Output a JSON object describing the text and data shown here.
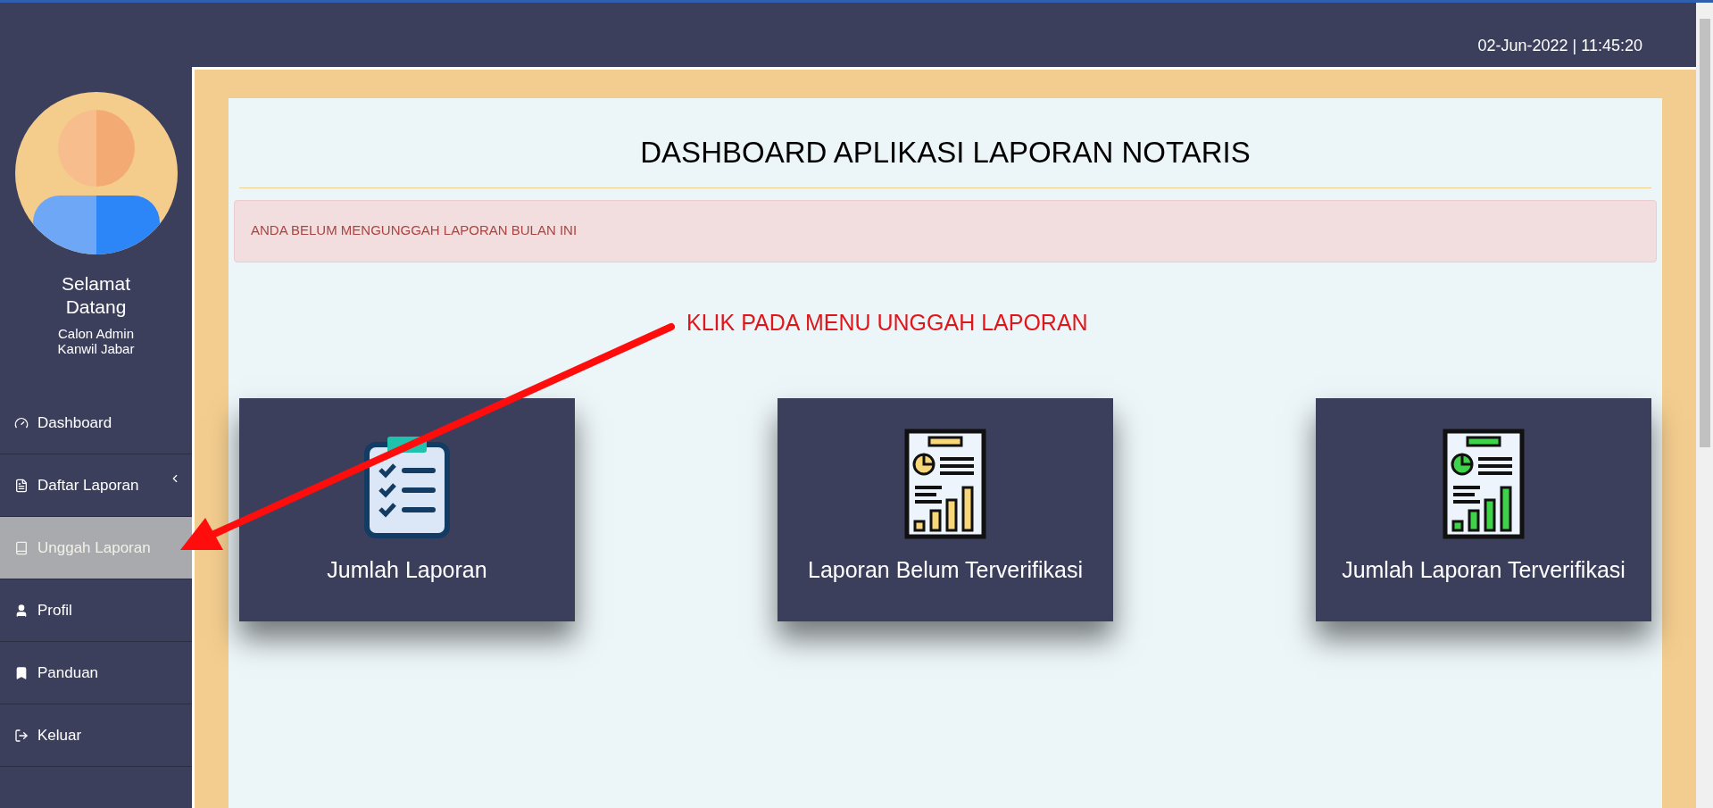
{
  "header": {
    "date_time": "02-Jun-2022 | 11:45:20"
  },
  "sidebar": {
    "greeting": "Selamat Datang",
    "user_lines": [
      "Calon Admin",
      "Kanwil Jabar"
    ],
    "menu": [
      {
        "label": "Dashboard",
        "kind": "gauge",
        "selected": false,
        "has_submenu": false
      },
      {
        "label": "Daftar Laporan",
        "kind": "file",
        "selected": false,
        "has_submenu": true
      },
      {
        "label": "Unggah Laporan",
        "kind": "book",
        "selected": true,
        "has_submenu": false
      },
      {
        "label": "Profil",
        "kind": "user",
        "selected": false,
        "has_submenu": false
      },
      {
        "label": "Panduan",
        "kind": "bookmark",
        "selected": false,
        "has_submenu": false
      },
      {
        "label": "Keluar",
        "kind": "logout",
        "selected": false,
        "has_submenu": false
      }
    ]
  },
  "main": {
    "title": "DASHBOARD APLIKASI LAPORAN NOTARIS",
    "alert": "ANDA BELUM MENGUNGGAH LAPORAN BULAN INI",
    "cards": [
      {
        "label": "Jumlah Laporan",
        "kind": "clipboard",
        "color": "#1fc3ad"
      },
      {
        "label": "Laporan Belum Terverifikasi",
        "kind": "report",
        "color": "#f7d77a"
      },
      {
        "label": "Jumlah Laporan Terverifikasi",
        "kind": "report",
        "color": "#3ed349"
      }
    ]
  },
  "annotation": {
    "text": "KLIK PADA MENU UNGGAH LAPORAN"
  }
}
